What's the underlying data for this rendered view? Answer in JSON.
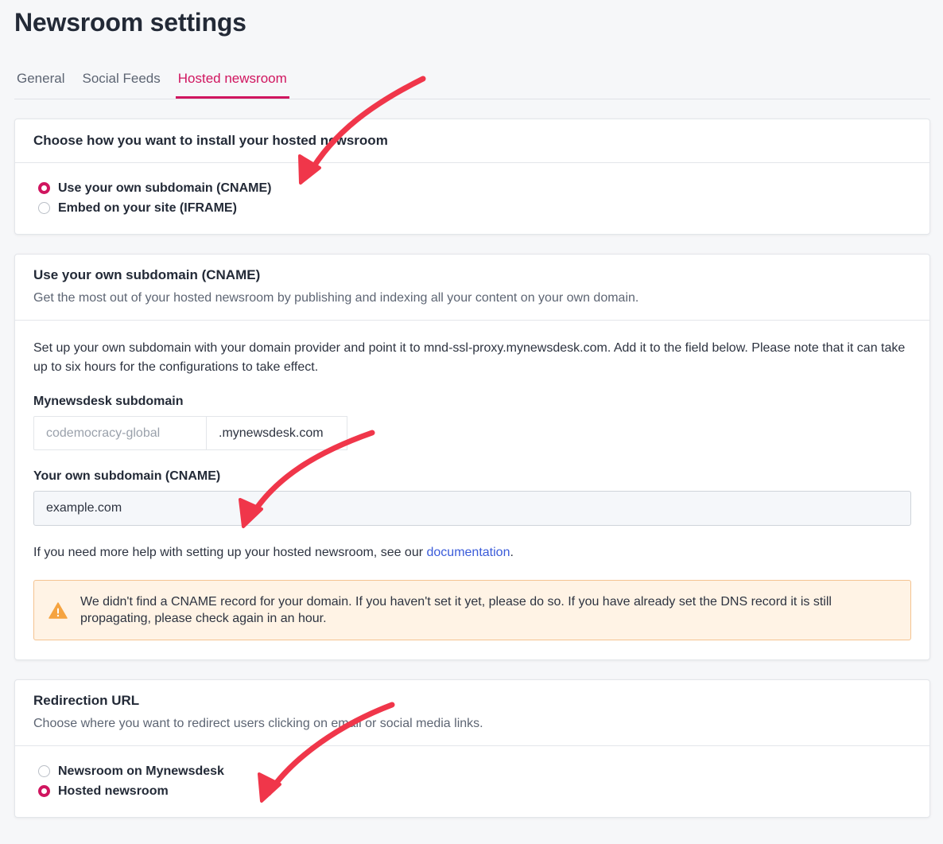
{
  "page": {
    "title": "Newsroom settings"
  },
  "tabs": [
    {
      "label": "General",
      "active": false
    },
    {
      "label": "Social Feeds",
      "active": false
    },
    {
      "label": "Hosted newsroom",
      "active": true
    }
  ],
  "install_card": {
    "title": "Choose how you want to install your hosted newsroom",
    "options": [
      {
        "label": "Use your own subdomain (CNAME)",
        "checked": true
      },
      {
        "label": "Embed on your site (IFRAME)",
        "checked": false
      }
    ]
  },
  "cname_card": {
    "title": "Use your own subdomain (CNAME)",
    "subtitle": "Get the most out of your hosted newsroom by publishing and indexing all your content on your own domain.",
    "instructions": "Set up your own subdomain with your domain provider and point it to mnd-ssl-proxy.mynewsdesk.com. Add it to the field below. Please note that it can take up to six hours for the configurations to take effect.",
    "mynewsdesk_label": "Mynewsdesk subdomain",
    "mynewsdesk_placeholder": "codemocracy-global",
    "mynewsdesk_suffix": ".mynewsdesk.com",
    "own_label": "Your own subdomain (CNAME)",
    "own_value": "example.com",
    "help_prefix": "If you need more help with setting up your hosted newsroom, see our ",
    "help_link": "documentation",
    "help_suffix": ".",
    "alert_text": "We didn't find a CNAME record for your domain. If you haven't set it yet, please do so. If you have already set the DNS record it is still propagating, please check again in an hour."
  },
  "redirect_card": {
    "title": "Redirection URL",
    "subtitle": "Choose where you want to redirect users clicking on email or social media links.",
    "options": [
      {
        "label": "Newsroom on Mynewsdesk",
        "checked": false
      },
      {
        "label": "Hosted newsroom",
        "checked": true
      }
    ]
  },
  "colors": {
    "accent": "#d0155f",
    "arrow": "#f0364a",
    "link": "#3a5bd9",
    "warning": "#f5a340"
  }
}
